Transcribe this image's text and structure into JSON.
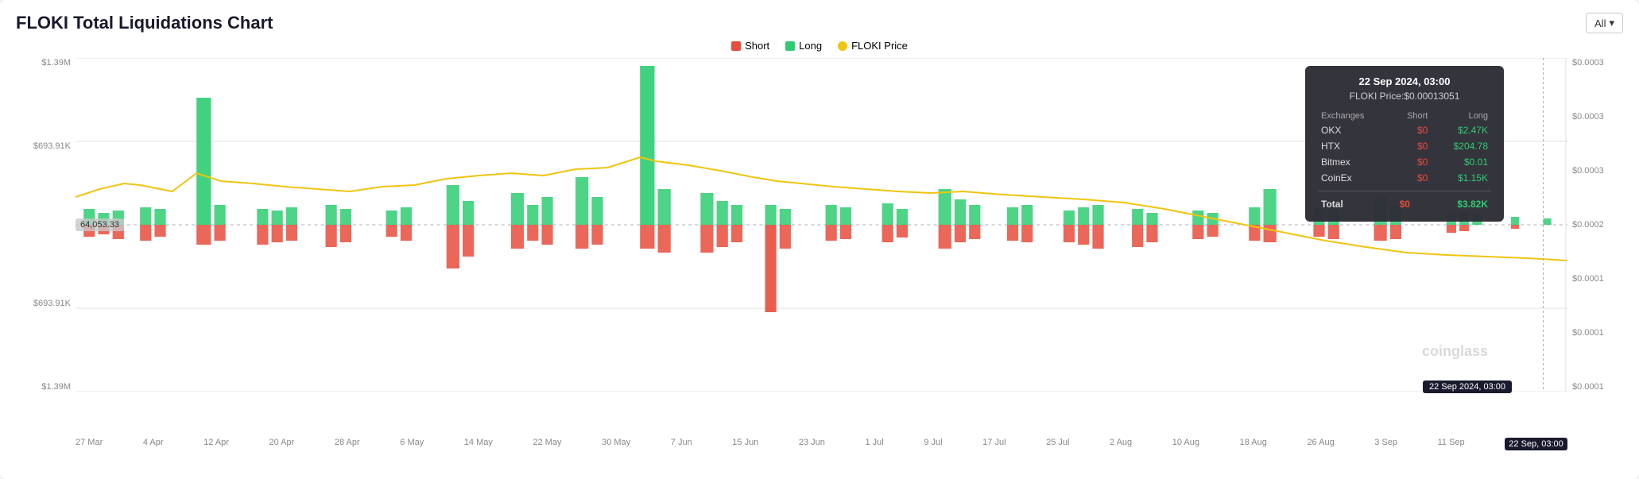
{
  "title": "FLOKI Total Liquidations Chart",
  "allButton": "All",
  "legend": {
    "short": "Short",
    "long": "Long",
    "price": "FLOKI Price"
  },
  "yAxisLeft": [
    "$1.39M",
    "$693.91K",
    "",
    "$693.91K",
    "$1.39M"
  ],
  "yAxisRight": [
    "$0.0003",
    "$0.0003",
    "$0.0003",
    "$0.0002",
    "$0.0001",
    "$0.0001",
    "$0.0001"
  ],
  "leftLabel": "64,053.33",
  "xAxisLabels": [
    "27 Mar",
    "4 Apr",
    "12 Apr",
    "20 Apr",
    "28 Apr",
    "6 May",
    "14 May",
    "22 May",
    "30 May",
    "7 Jun",
    "15 Jun",
    "23 Jun",
    "1 Jul",
    "9 Jul",
    "17 Jul",
    "25 Jul",
    "2 Aug",
    "10 Aug",
    "18 Aug",
    "26 Aug",
    "3 Sep",
    "11 Sep",
    "22 Sep, 03:00"
  ],
  "tooltip": {
    "date": "22 Sep 2024, 03:00",
    "price": "FLOKI Price:$0.00013051",
    "columns": [
      "Exchanges",
      "Short",
      "Long"
    ],
    "rows": [
      {
        "exchange": "OKX",
        "short": "$0",
        "long": "$2.47K"
      },
      {
        "exchange": "HTX",
        "short": "$0",
        "long": "$204.78"
      },
      {
        "exchange": "Bitmex",
        "short": "$0",
        "long": "$0.01"
      },
      {
        "exchange": "CoinEx",
        "short": "$0",
        "long": "$1.15K"
      }
    ],
    "total": {
      "label": "Total",
      "short": "$0",
      "long": "$3.82K"
    }
  },
  "dateBadge": "22 Sep 2024, 03:00",
  "watermark": "coinglass"
}
